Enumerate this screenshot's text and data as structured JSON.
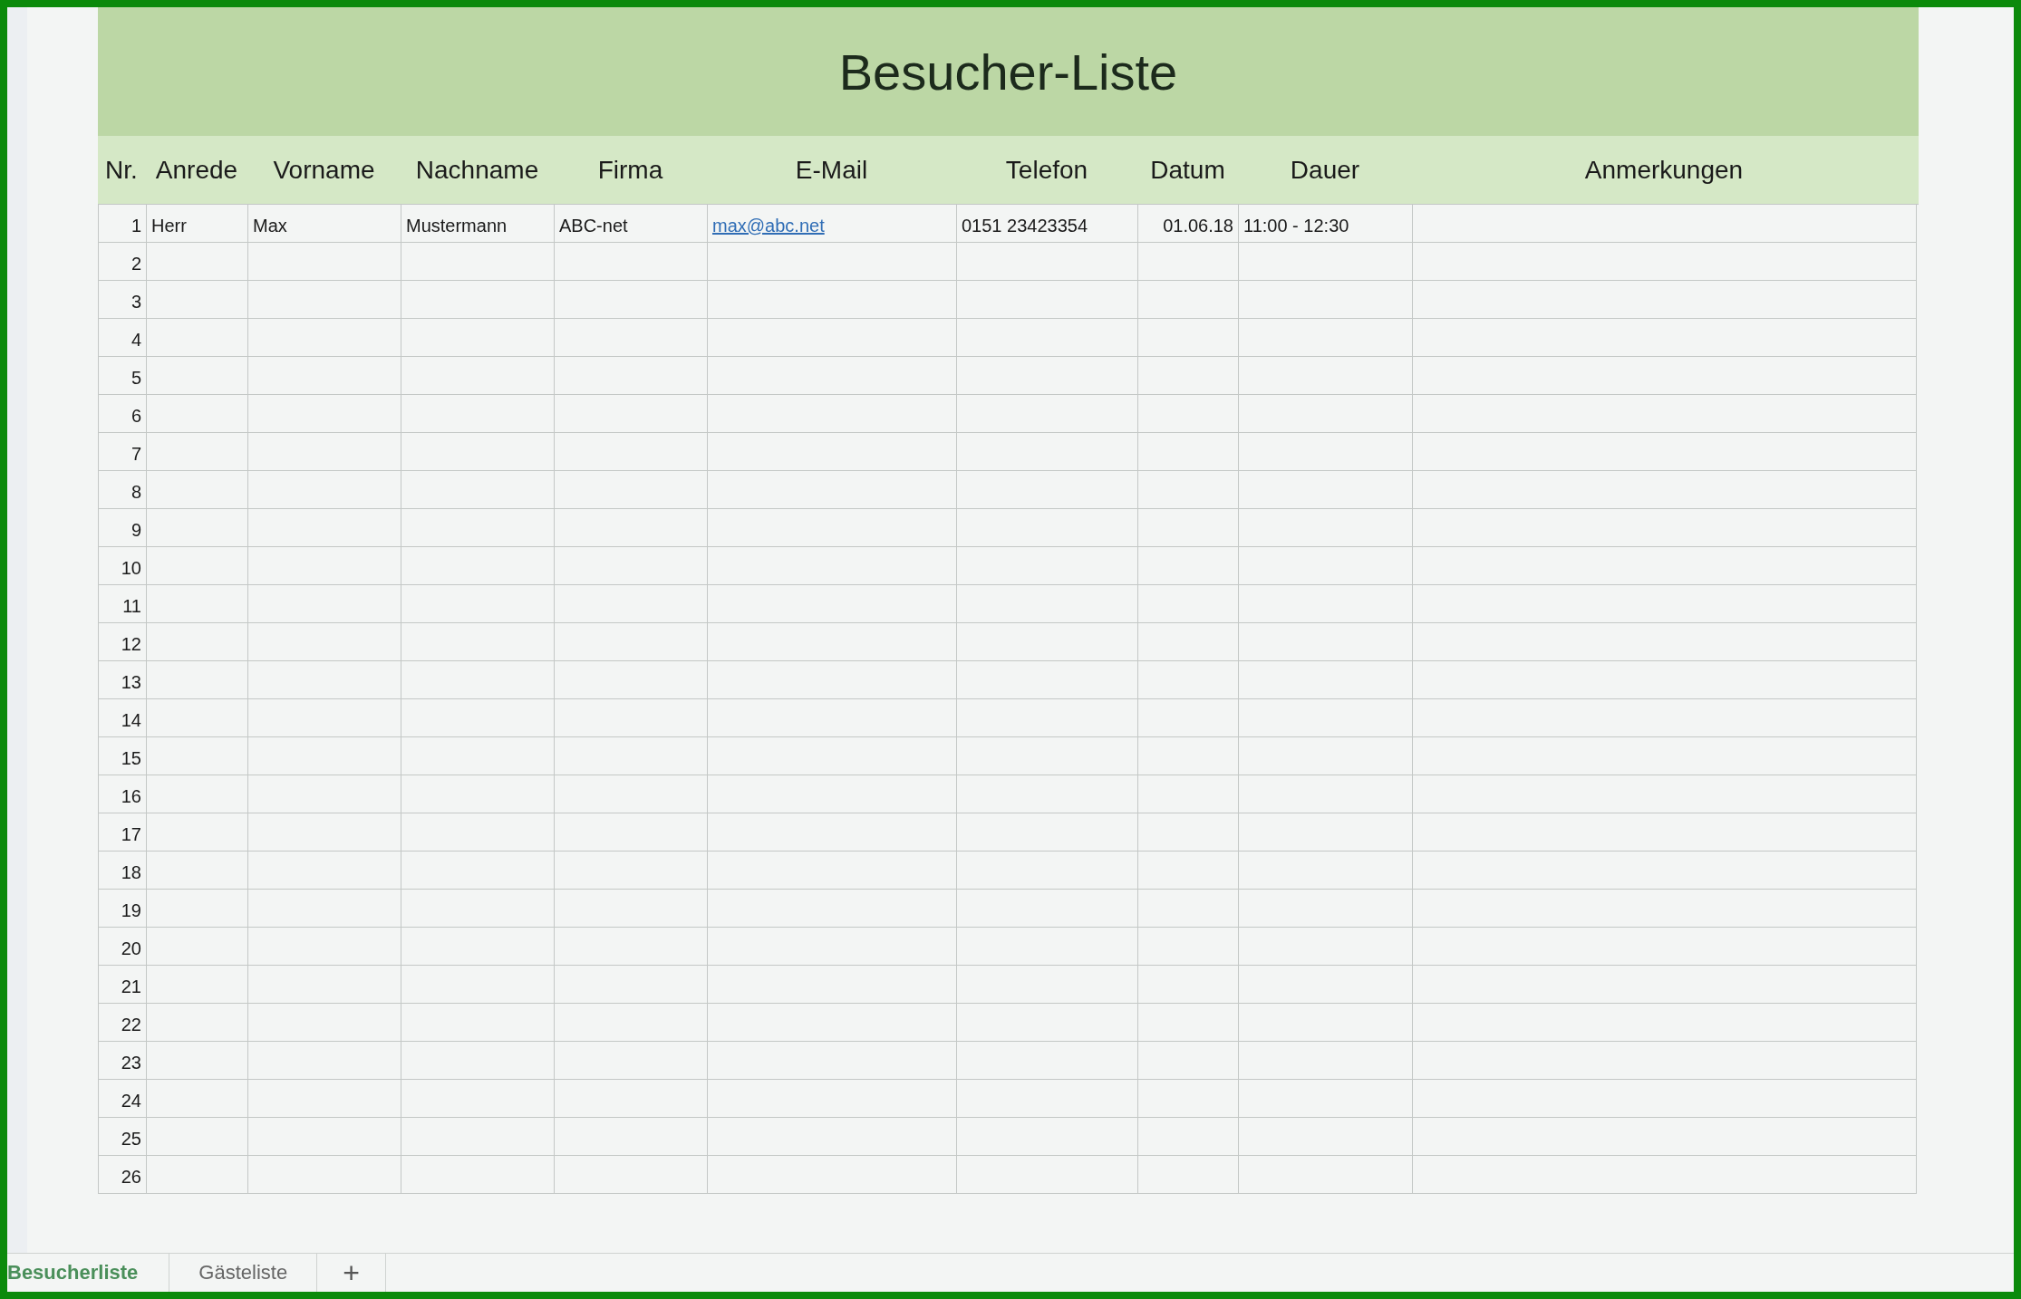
{
  "title": "Besucher-Liste",
  "columns": [
    {
      "label": "Nr.",
      "kind": "number"
    },
    {
      "label": "Anrede",
      "kind": "text"
    },
    {
      "label": "Vorname",
      "kind": "text"
    },
    {
      "label": "Nachname",
      "kind": "text"
    },
    {
      "label": "Firma",
      "kind": "text"
    },
    {
      "label": "E-Mail",
      "kind": "link"
    },
    {
      "label": "Telefon",
      "kind": "text"
    },
    {
      "label": "Datum",
      "kind": "date"
    },
    {
      "label": "Dauer",
      "kind": "text"
    },
    {
      "label": "Anmerkungen",
      "kind": "text"
    }
  ],
  "rows": [
    {
      "nr": "1",
      "values": [
        "Herr",
        "Max",
        "Mustermann",
        "ABC-net",
        "max@abc.net",
        "0151 23423354",
        "01.06.18",
        "11:00 - 12:30"
      ]
    },
    {
      "nr": "2"
    },
    {
      "nr": "3"
    },
    {
      "nr": "4"
    },
    {
      "nr": "5"
    },
    {
      "nr": "6"
    },
    {
      "nr": "7"
    },
    {
      "nr": "8"
    },
    {
      "nr": "9"
    },
    {
      "nr": "10"
    },
    {
      "nr": "11"
    },
    {
      "nr": "12"
    },
    {
      "nr": "13"
    },
    {
      "nr": "14"
    },
    {
      "nr": "15"
    },
    {
      "nr": "16"
    },
    {
      "nr": "17"
    },
    {
      "nr": "18"
    },
    {
      "nr": "19"
    },
    {
      "nr": "20"
    },
    {
      "nr": "21"
    },
    {
      "nr": "22"
    },
    {
      "nr": "23"
    },
    {
      "nr": "24"
    },
    {
      "nr": "25"
    },
    {
      "nr": "26"
    }
  ],
  "sheet_tabs": [
    {
      "label": "Besucherliste",
      "selected": true
    },
    {
      "label": "Gästeliste",
      "selected": false
    }
  ],
  "add_sheet": "+"
}
